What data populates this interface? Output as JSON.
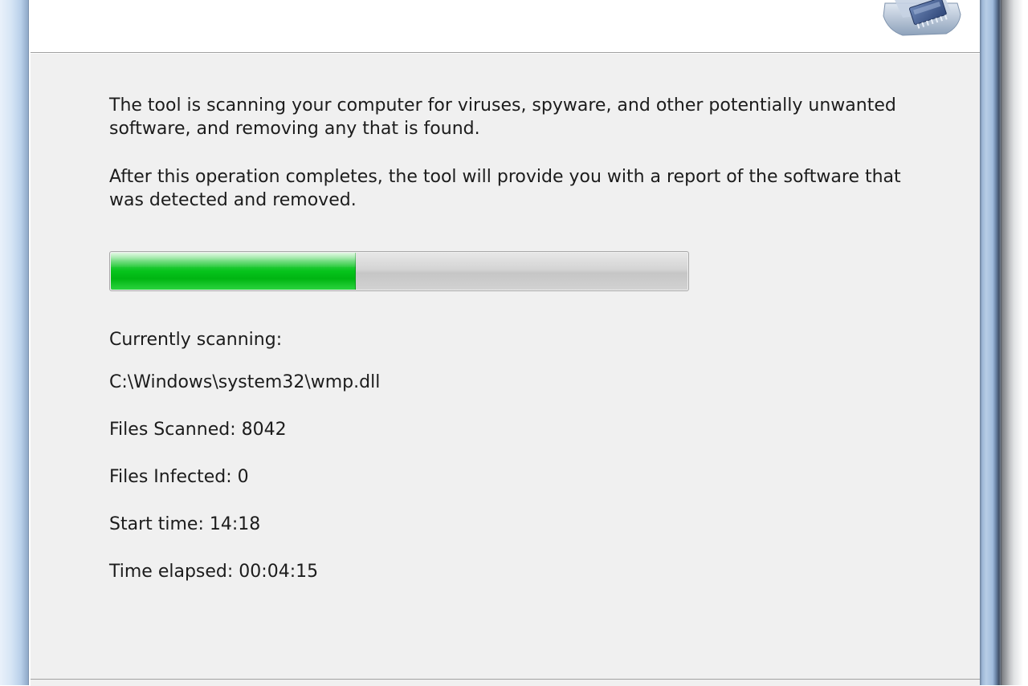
{
  "intro": {
    "paragraph_1": "The tool is scanning your computer for viruses, spyware, and other potentially unwanted software, and removing any that is found.",
    "paragraph_2": "After this operation completes, the tool will provide you with a report of the software that was detected and removed."
  },
  "progress": {
    "fraction": 0.425,
    "fill_color": "#06c41c",
    "track_color": "#d0d0d0"
  },
  "status": {
    "currently_scanning_label": "Currently scanning:",
    "current_file": "C:\\Windows\\system32\\wmp.dll",
    "files_scanned": "Files Scanned: 8042",
    "files_infected": "Files Infected: 0",
    "start_time": "Start time: 14:18",
    "time_elapsed": "Time elapsed: 00:04:15"
  },
  "icons": {
    "header_icon": "malware-removal-tool-icon"
  }
}
